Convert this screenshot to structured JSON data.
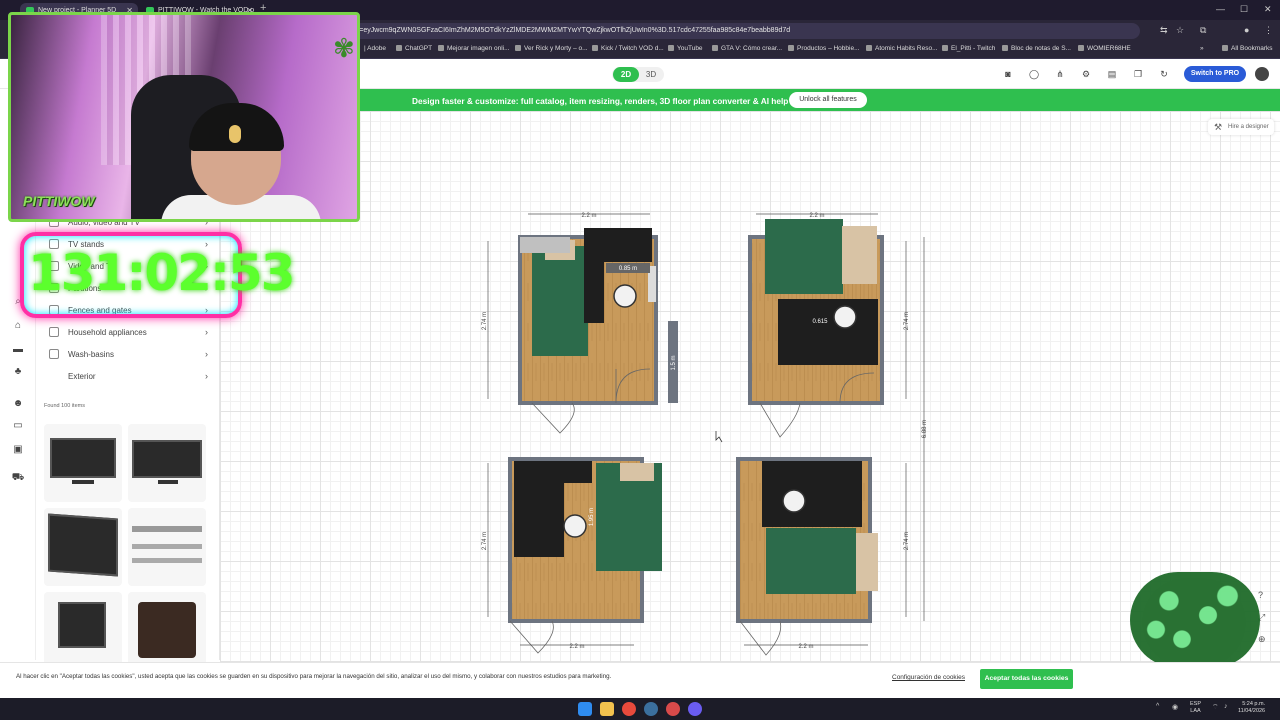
{
  "browser": {
    "tabs": [
      {
        "title": "New project - Planner 5D",
        "active": true
      },
      {
        "title": "PITTIWOW - Watch the VOD o",
        "active": false
      }
    ],
    "url": "ken=eyJwcm9qZWN0SGFzaCI6ImZhM2M5OTdkYzZlMDE2MWM2MTYwYTQwZjkwOTlhZjUwIn0%3D.517cdc47255faa985c84e7beabb89d7d",
    "bookmarks": [
      "| Adobe",
      "ChatGPT",
      "Mejorar imagen onli...",
      "Ver Rick y Morty – o...",
      "Kick / Twitch VOD d...",
      "YouTube",
      "GTA V: Cómo crear...",
      "Productos – Hobbie...",
      "Atomic Habits Reso...",
      "El_Pitti - Twitch",
      "Bloc de notas de S...",
      "WOMIER68HE"
    ],
    "all_bookmarks": "All Bookmarks"
  },
  "app": {
    "view_2d": "2D",
    "view_3d": "3D",
    "toolbar_icons": [
      "camera-icon",
      "chat-icon",
      "share-icon",
      "settings-icon",
      "store-icon",
      "copy-icon",
      "refresh-icon"
    ],
    "switch_pro": "Switch to PRO",
    "promo_text": "Design faster & customize: full catalog, item resizing, renders, 3D floor plan converter & AI help",
    "unlock": "Unlock all features",
    "hire": "Hire a designer"
  },
  "sidebar": {
    "categories": [
      {
        "label": "Audio, video and TV"
      },
      {
        "label": "TV stands"
      },
      {
        "label": "Video and TV"
      },
      {
        "label": "Partitions"
      },
      {
        "label": "Fences and gates"
      },
      {
        "label": "Household appliances"
      },
      {
        "label": "Wash-basins"
      },
      {
        "label": "Exterior"
      }
    ],
    "found": "Found 100 items"
  },
  "plans": {
    "dims": {
      "width_22": "2.2 m",
      "height_274": "2.74 m",
      "d085": "0.85 m",
      "d15": "1.5 m",
      "d195": "1.95 m",
      "d0615": "0.615",
      "total": "6.88 m"
    }
  },
  "overlay": {
    "timer": "131:02:53",
    "brand": "PITTIWOW"
  },
  "cookie": {
    "text": "Al hacer clic en \"Aceptar todas las cookies\", usted acepta que las cookies se guarden en su dispositivo para mejorar la navegación del sitio, analizar el uso del mismo, y colaborar con nuestros estudios para marketing.",
    "config": "Configuración de cookies",
    "accept": "Aceptar todas las cookies"
  },
  "taskbar": {
    "lang_top": "ESP",
    "lang_bottom": "LAA",
    "time": "5:24 p.m.",
    "date": "11/04/2026"
  }
}
